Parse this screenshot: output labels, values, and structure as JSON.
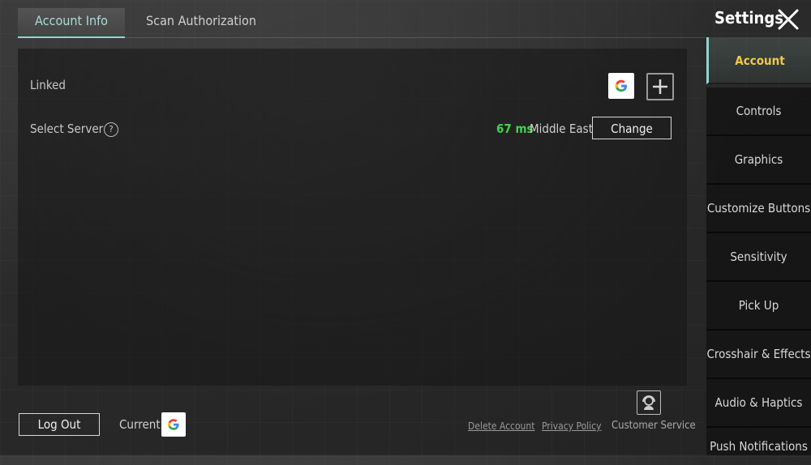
{
  "tabs": {
    "account_info": "Account Info",
    "scan_authorization": "Scan Authorization"
  },
  "header": {
    "title": "Settings"
  },
  "account": {
    "linked_label": "Linked",
    "select_server_label": "Select Server",
    "help_symbol": "?",
    "ping_value": "67 ms",
    "region": "Middle East",
    "change_button": "Change"
  },
  "footer": {
    "logout_button": "Log Out",
    "current_label": "Current",
    "delete_account": "Delete Account",
    "privacy_policy": "Privacy Policy",
    "customer_service": "Customer Service"
  },
  "sidebar": {
    "items": [
      {
        "label": "Account"
      },
      {
        "label": "Controls"
      },
      {
        "label": "Graphics"
      },
      {
        "label": "Customize Buttons"
      },
      {
        "label": "Sensitivity"
      },
      {
        "label": "Pick Up"
      },
      {
        "label": "Crosshair & Effects"
      },
      {
        "label": "Audio & Haptics"
      },
      {
        "label": "Push Notifications"
      }
    ]
  },
  "colors": {
    "accent": "#8fd6cc",
    "active_sidebar_text": "#f3c84b",
    "ping_green": "#42d24a"
  },
  "icons": {
    "close": "close-icon",
    "google": "google-icon",
    "add": "plus-icon",
    "help": "help-icon",
    "customer_service": "headset-icon"
  }
}
